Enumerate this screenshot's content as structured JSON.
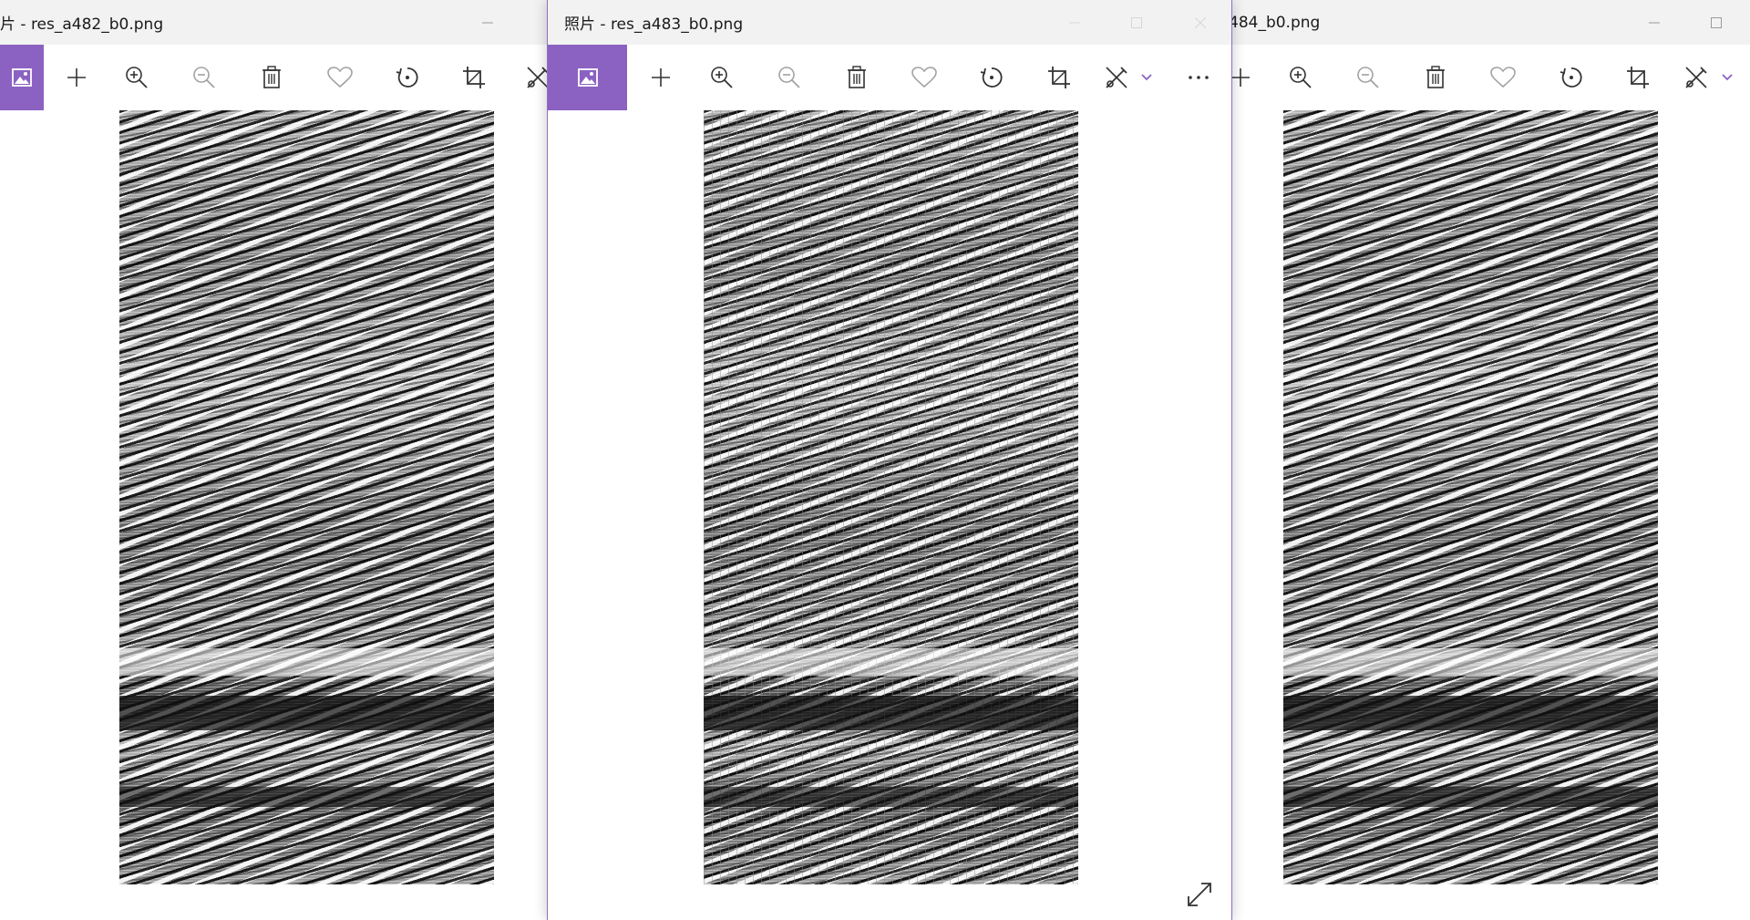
{
  "colors": {
    "accent": "#8b62c1",
    "titlebar_bg": "#f2f2f2",
    "icon": "#333333",
    "icon_dim": "#9a9a9a",
    "window_border": "#8f6fc4"
  },
  "windows": [
    {
      "id": "w1",
      "title": "片 - res_a482_b0.png",
      "state": "background",
      "toolbar": [
        "image-icon",
        "add-icon",
        "zoom-in-icon",
        "zoom-out-icon",
        "delete-icon",
        "favorite-icon",
        "rotate-icon",
        "crop-icon",
        "edit-icon"
      ],
      "window_controls": [
        "minimize-icon"
      ]
    },
    {
      "id": "w2",
      "title": "照片 - res_a483_b0.png",
      "state": "active",
      "toolbar": [
        "image-icon",
        "add-icon",
        "zoom-in-icon",
        "zoom-out-icon",
        "delete-icon",
        "favorite-icon",
        "rotate-icon",
        "crop-icon",
        "edit-icon",
        "chevron-down-icon",
        "more-icon"
      ],
      "window_controls": [
        "minimize-icon",
        "maximize-icon",
        "close-icon"
      ],
      "bottom_action": "expand-icon"
    },
    {
      "id": "w3",
      "title": "484_b0.png",
      "state": "background",
      "toolbar": [
        "add-icon",
        "zoom-in-icon",
        "zoom-out-icon",
        "delete-icon",
        "favorite-icon",
        "rotate-icon",
        "crop-icon",
        "edit-icon",
        "chevron-down-icon"
      ],
      "window_controls": [
        "minimize-icon",
        "maximize-icon"
      ]
    }
  ]
}
